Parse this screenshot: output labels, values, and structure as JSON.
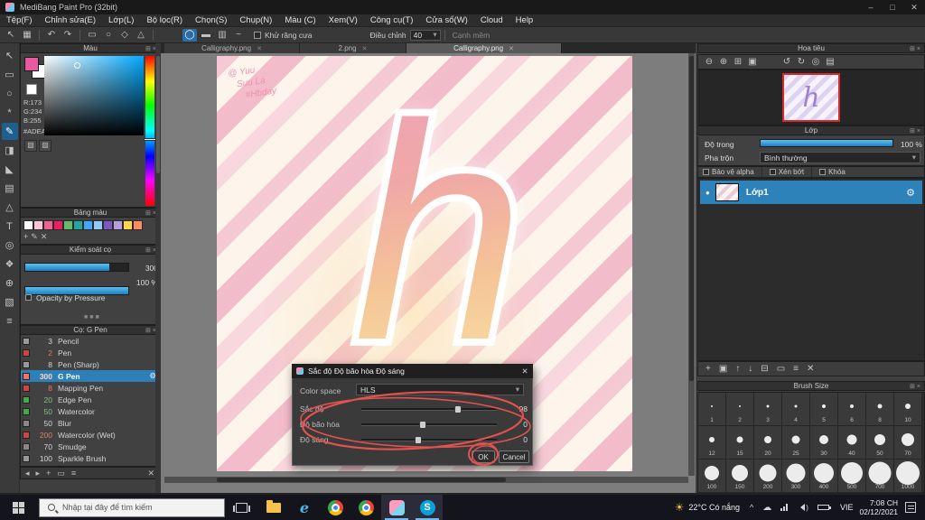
{
  "window": {
    "title": "MediBang Paint Pro (32bit)"
  },
  "menu": {
    "items": [
      "Tệp(F)",
      "Chỉnh sửa(E)",
      "Lớp(L)",
      "Bộ lọc(R)",
      "Chọn(S)",
      "Chụp(N)",
      "Màu (C)",
      "Xem(V)",
      "Công cụ(T)",
      "Cửa sổ(W)",
      "Cloud",
      "Help"
    ]
  },
  "toolbar": {
    "antialias": "Khử răng cưa",
    "adjust": "Điều chỉnh",
    "adjust_value": "40",
    "soft_edge": "Cạnh mềm"
  },
  "tabs": [
    {
      "label": "Calligraphy.png"
    },
    {
      "label": "2.png"
    },
    {
      "label": "Calligraphy.png"
    }
  ],
  "color_panel": {
    "title": "Màu",
    "r": "R:173",
    "g": "G:234",
    "b": "B:255",
    "hex": "#ADEAFF",
    "foreground": "#e85aa0",
    "background": "#ffffff"
  },
  "palette": {
    "title": "Bảng màu",
    "swatches": [
      "#ffffff",
      "#f7c6d9",
      "#f06292",
      "#e91e63",
      "#66bb6a",
      "#26a69a",
      "#42a5f5",
      "#90caf9",
      "#7e57c2",
      "#b39ddb",
      "#ffd54f",
      "#ff8a65"
    ]
  },
  "brush_control": {
    "title": "Kiểm soát cọ",
    "size": "300",
    "opacity": "100 %",
    "pressure": "Opacity by Pressure"
  },
  "brushes": {
    "title": "Cọ: G Pen",
    "items": [
      {
        "size": "3",
        "name": "Pencil",
        "color": "#9a9a9a"
      },
      {
        "size": "2",
        "name": "Pen",
        "color": "#cc4444"
      },
      {
        "size": "8",
        "name": "Pen (Sharp)",
        "color": "#9a9a9a"
      },
      {
        "size": "300",
        "name": "G Pen",
        "color": "#ff7060"
      },
      {
        "size": "8",
        "name": "Mapping Pen",
        "color": "#cc4444"
      },
      {
        "size": "20",
        "name": "Edge Pen",
        "color": "#44aa44"
      },
      {
        "size": "50",
        "name": "Watercolor",
        "color": "#44aa44"
      },
      {
        "size": "50",
        "name": "Blur",
        "color": "#888888"
      },
      {
        "size": "200",
        "name": "Watercolor (Wet)",
        "color": "#cc4444"
      },
      {
        "size": "70",
        "name": "Smudge",
        "color": "#888888"
      },
      {
        "size": "100",
        "name": "Sparkle Brush",
        "color": "#9a9a9a"
      }
    ]
  },
  "canvas": {
    "note_lines": [
      "@ Yuu",
      "Suu Lá",
      "#Hbday"
    ],
    "letter": "h"
  },
  "dialog": {
    "title": "Sắc độ Độ bão hòa Độ sáng",
    "color_space_label": "Color space",
    "color_space": "HLS",
    "sliders": [
      {
        "label": "Sắc độ",
        "value": "98",
        "pos": 71
      },
      {
        "label": "Độ bão hòa",
        "value": "0",
        "pos": 45
      },
      {
        "label": "Độ sáng",
        "value": "0",
        "pos": 42
      }
    ],
    "ok": "OK",
    "cancel": "Cancel"
  },
  "navigator": {
    "title": "Hoa tiêu"
  },
  "layers": {
    "title": "Lớp",
    "opacity_label": "Độ trong",
    "opacity": "100 %",
    "blend_label": "Pha trộn",
    "blend": "Bình thường",
    "alpha": "Bảo vệ alpha",
    "clip": "Xén bớt",
    "lock": "Khóa",
    "name": "Lớp1"
  },
  "brush_size": {
    "title": "Brush Size",
    "rows": [
      [
        "1",
        "2",
        "3",
        "4",
        "5",
        "6",
        "8",
        "10"
      ],
      [
        "12",
        "15",
        "20",
        "25",
        "30",
        "40",
        "50",
        "70"
      ],
      [
        "100",
        "150",
        "200",
        "300",
        "400",
        "500",
        "700",
        "1000"
      ]
    ]
  },
  "taskbar": {
    "search": "Nhập tại đây để tìm kiếm",
    "weather": "22°C Có nắng",
    "lang": "VIE",
    "time": "7:08 CH",
    "date": "02/12/2021"
  }
}
